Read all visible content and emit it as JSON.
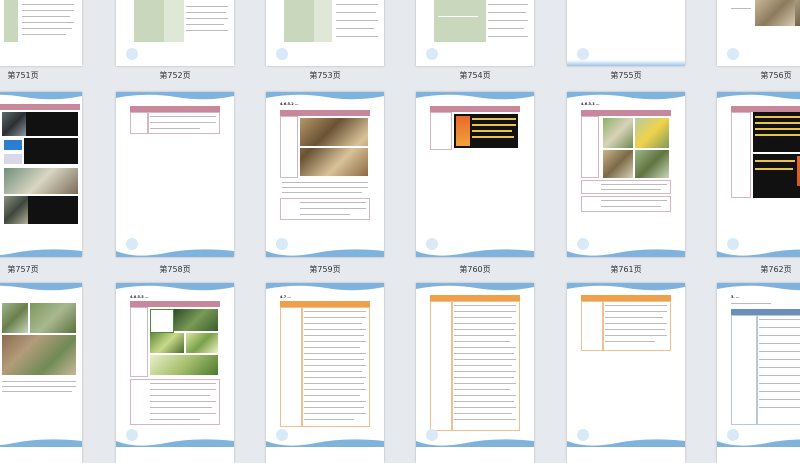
{
  "pages": [
    {
      "id": "p751",
      "label": "第751页"
    },
    {
      "id": "p752",
      "label": "第752页"
    },
    {
      "id": "p753",
      "label": "第753页"
    },
    {
      "id": "p754",
      "label": "第754页"
    },
    {
      "id": "p755",
      "label": "第755页"
    },
    {
      "id": "p756",
      "label": "第756页"
    },
    {
      "id": "p757",
      "label": "第757页"
    },
    {
      "id": "p758",
      "label": "第758页"
    },
    {
      "id": "p759",
      "label": "第759页"
    },
    {
      "id": "p760",
      "label": "第760页"
    },
    {
      "id": "p761",
      "label": "第761页"
    },
    {
      "id": "p762",
      "label": "第762页"
    }
  ],
  "page_titles": {
    "p759": "4.6.5.2 …",
    "p761": "4.6.5.3 …",
    "p764": "4.6.5.5 …",
    "p765": "4.7 …",
    "p768": "5. …"
  },
  "colors": {
    "background": "#e6e9ed",
    "header_pink": "#c8889b",
    "header_orange": "#f0a04a",
    "wave_blue": "#7fb3de",
    "table_green": "#c9d7bd"
  }
}
